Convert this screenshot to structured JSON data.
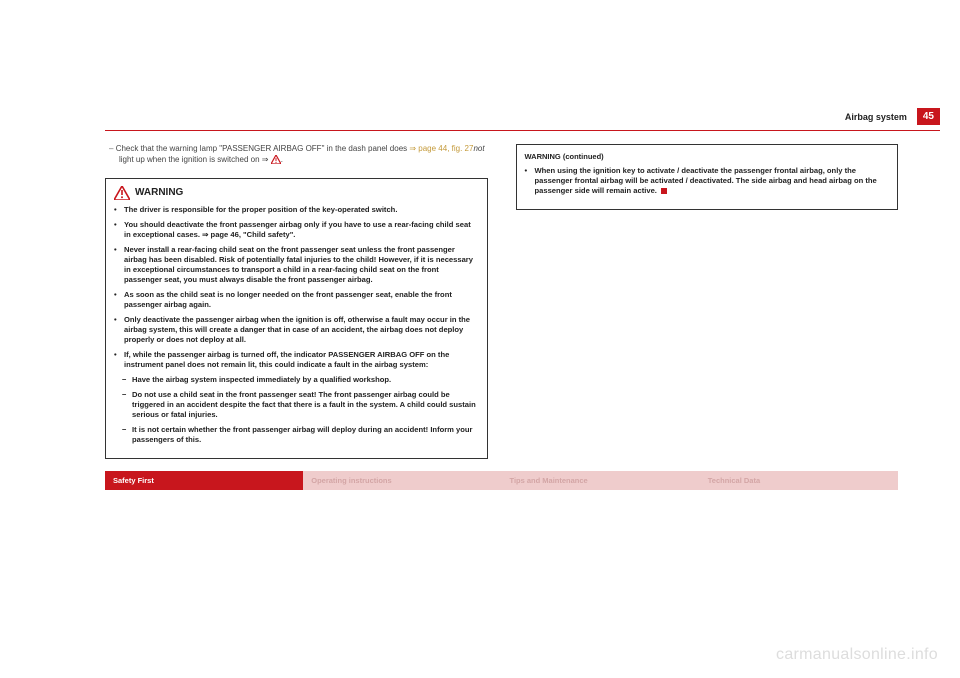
{
  "header": {
    "section": "Airbag system",
    "page": "45"
  },
  "instruction": {
    "prefix": "–",
    "text_a": "Check that the warning lamp \"PASSENGER AIRBAG OFF\" in the dash panel does ",
    "link": "⇒ page 44, fig. 27",
    "not": "not",
    "text_b": " light up when the ignition is switched on ⇒ "
  },
  "warning1": {
    "title": "WARNING",
    "items": [
      "The driver is responsible for the proper position of the key-operated switch.",
      "You should deactivate the front passenger airbag only if you have to use a rear-facing child seat in exceptional cases. ⇒ page 46, \"Child safety\".",
      "Never install a rear-facing child seat on the front passenger seat unless the front passenger airbag has been disabled. Risk of potentially fatal injuries to the child! However, if it is necessary in exceptional circumstances to transport a child in a rear-facing child seat on the front passenger seat, you must always disable the front passenger airbag.",
      "As soon as the child seat is no longer needed on the front passenger seat, enable the front passenger airbag again.",
      "Only deactivate the passenger airbag when the ignition is off, otherwise a fault may occur in the airbag system, this will create a danger that in case of an accident, the airbag does not deploy properly or does not deploy at all.",
      "If, while the passenger airbag is turned off, the indicator PASSENGER AIRBAG OFF on the instrument panel does not remain lit, this could indicate a fault in the airbag system:"
    ],
    "subs": [
      "Have the airbag system inspected immediately by a qualified workshop.",
      "Do not use a child seat in the front passenger seat! The front passenger airbag could be triggered in an accident despite the fact that there is a fault in the system. A child could sustain serious or fatal injuries.",
      "It is not certain whether the front passenger airbag will deploy during an accident! Inform your passengers of this."
    ]
  },
  "warning2": {
    "title": "WARNING (continued)",
    "text": "When using the ignition key to activate / deactivate the passenger frontal airbag, only the passenger frontal airbag will be activated / deactivated. The side airbag and head airbag on the passenger side will remain active."
  },
  "footer": {
    "a": "Safety First",
    "b": "Operating instructions",
    "c": "Tips and Maintenance",
    "d": "Technical Data"
  },
  "watermark": "carmanualsonline.info"
}
